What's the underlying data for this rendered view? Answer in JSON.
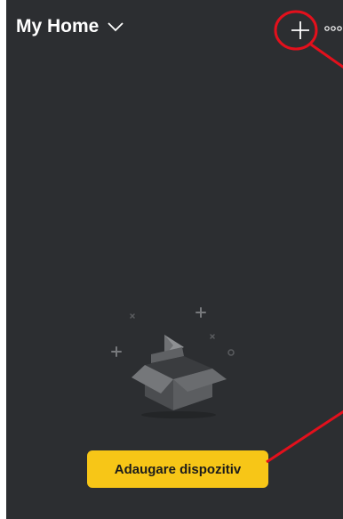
{
  "header": {
    "title": "My Home",
    "title_icon": "chevron-down-icon",
    "add_icon": "plus-icon",
    "more_icon": "more-dots-icon"
  },
  "main": {
    "empty_illustration": "empty-box-icon",
    "add_device_label": "Adaugare dispozitiv"
  },
  "colors": {
    "background": "#2c2e31",
    "accent": "#f7c617",
    "annotation": "#e3101c"
  }
}
